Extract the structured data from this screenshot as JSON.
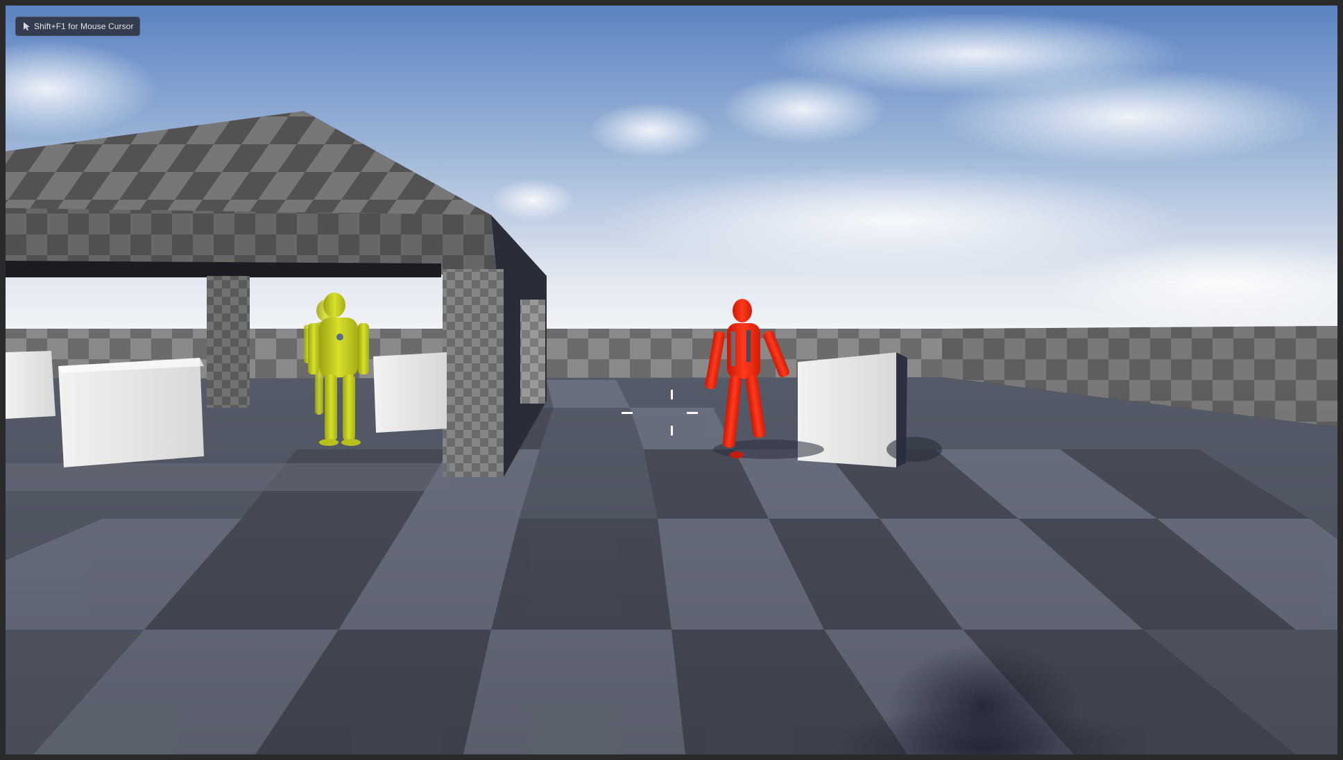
{
  "hud": {
    "mouse_hint": "Shift+F1 for Mouse Cursor",
    "mouse_hint_icon": "mouse-cursor-icon",
    "crosshair_icon": "crosshair-icon"
  },
  "scene": {
    "description_tags": [
      "sky",
      "checker-floor",
      "pavilion",
      "crates",
      "yellow-mannequin",
      "red-mannequin",
      "player-shadow"
    ],
    "colors": {
      "sky_top": "#5d86c4",
      "sky_bottom": "#eef1f5",
      "floor_dark": "#4a4e5c",
      "floor_light": "#6a6f7e",
      "yellow_character": "#c8d21e",
      "red_character": "#ff2a14",
      "crate": "#e8e8e6"
    }
  }
}
